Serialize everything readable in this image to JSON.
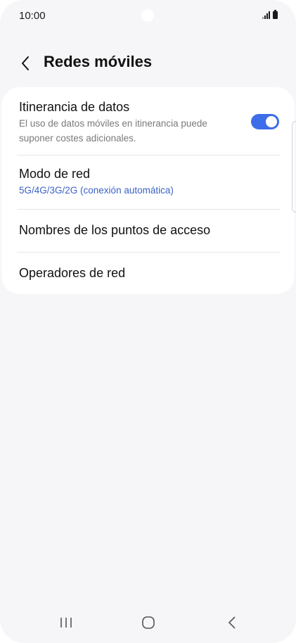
{
  "status_bar": {
    "time": "10:00",
    "icons": [
      "signal-icon",
      "battery-icon"
    ]
  },
  "header": {
    "title": "Redes móviles",
    "back_icon": "chevron-left-icon"
  },
  "settings": [
    {
      "title": "Itinerancia de datos",
      "subtitle": "El uso de datos móviles en itinerancia puede suponer costes adicionales.",
      "toggle_on": true
    },
    {
      "title": "Modo de red",
      "value": "5G/4G/3G/2G (conexión automática)"
    },
    {
      "title": "Nombres de los puntos de acceso"
    },
    {
      "title": "Operadores de red"
    }
  ],
  "navigation": {
    "buttons": [
      "recent-apps-icon",
      "home-icon",
      "back-icon"
    ]
  },
  "colors": {
    "accent": "#3d6de8",
    "background": "#f6f6f8",
    "card": "#ffffff",
    "text": "#111111",
    "subtitle": "#7a7a7a",
    "link_value": "#3b63c4"
  }
}
